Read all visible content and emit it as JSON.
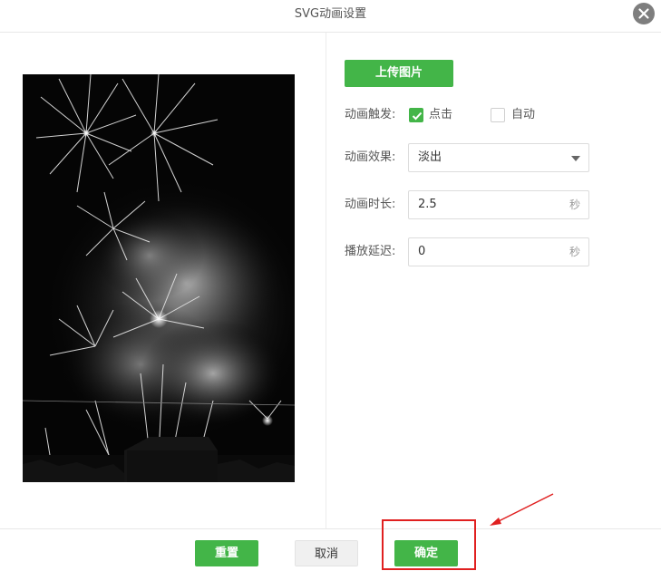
{
  "dialog": {
    "title": "SVG动画设置",
    "close_icon": "close-icon"
  },
  "preview": {
    "image_description_icon": "fireworks-image"
  },
  "settings": {
    "upload_label": "上传图片",
    "trigger": {
      "label": "动画触发:",
      "options": [
        {
          "label": "点击",
          "checked": true
        },
        {
          "label": "自动",
          "checked": false
        }
      ]
    },
    "effect": {
      "label": "动画效果:",
      "value": "淡出"
    },
    "duration": {
      "label": "动画时长:",
      "value": "2.5",
      "unit": "秒"
    },
    "delay": {
      "label": "播放延迟:",
      "value": "0",
      "unit": "秒"
    }
  },
  "footer": {
    "reset_label": "重置",
    "cancel_label": "取消",
    "confirm_label": "确定"
  },
  "colors": {
    "accent": "#43b548",
    "annotation": "#e02020"
  }
}
